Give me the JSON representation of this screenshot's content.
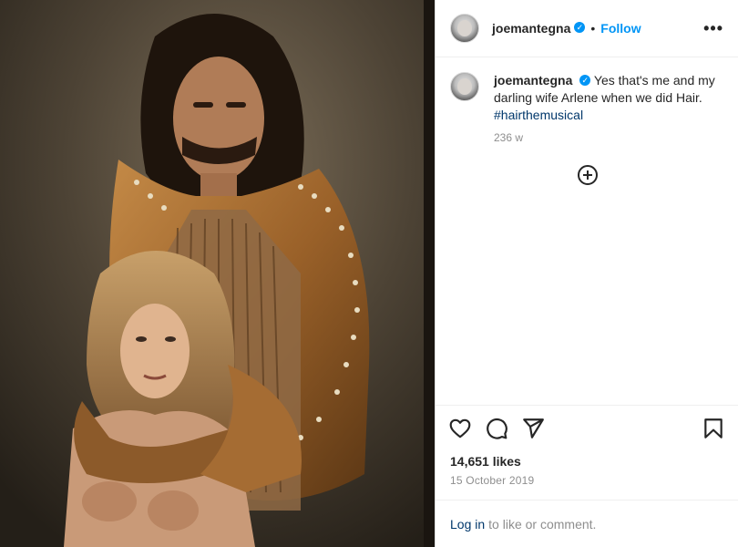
{
  "post": {
    "username": "joemantegna",
    "follow_label": "Follow",
    "dot": "•",
    "more_label": "•••",
    "verified_glyph": "✓",
    "caption_text": "Yes that's me and my darling wife Arlene when we did Hair.",
    "hashtag": "#hairthemusical",
    "time_ago": "236 w",
    "likes": "14,651 likes",
    "date": "15 October 2019",
    "login_link": "Log in",
    "login_suffix": "to like or comment.",
    "icons": [
      "heart-icon",
      "comment-icon",
      "share-icon",
      "bookmark-icon",
      "plus-circle-icon",
      "more-icon"
    ],
    "colors": {
      "accent": "#0095f6",
      "link": "#00376b",
      "muted": "#8e8e8e"
    }
  }
}
